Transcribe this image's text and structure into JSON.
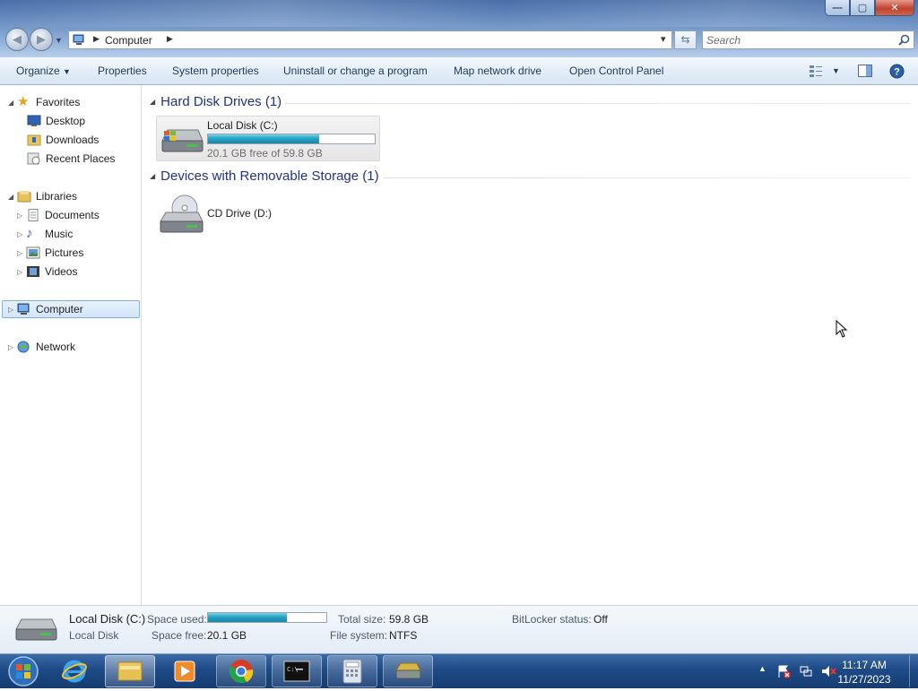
{
  "window": {
    "controls": {
      "minimize": "—",
      "maximize": "▢",
      "close": "✕"
    }
  },
  "nav": {
    "back_icon": "back-arrow-icon",
    "forward_icon": "forward-arrow-icon",
    "breadcrumb": [
      "Computer"
    ],
    "address_dropdown": "▾",
    "refresh_icon": "refresh-icon",
    "search_placeholder": "Search"
  },
  "toolbar": {
    "organize": "Organize",
    "properties": "Properties",
    "system_properties": "System properties",
    "uninstall": "Uninstall or change a program",
    "map_drive": "Map network drive",
    "control_panel": "Open Control Panel"
  },
  "sidebar": {
    "favorites": {
      "label": "Favorites",
      "items": [
        "Desktop",
        "Downloads",
        "Recent Places"
      ]
    },
    "libraries": {
      "label": "Libraries",
      "items": [
        "Documents",
        "Music",
        "Pictures",
        "Videos"
      ]
    },
    "computer": "Computer",
    "network": "Network"
  },
  "groups": {
    "hdd": {
      "title": "Hard Disk Drives (1)"
    },
    "removable": {
      "title": "Devices with Removable Storage (1)"
    }
  },
  "drives": {
    "c": {
      "name": "Local Disk (C:)",
      "free_text": "20.1 GB free of 59.8 GB",
      "used_fraction": 0.664
    },
    "d": {
      "name": "CD Drive (D:)"
    }
  },
  "details": {
    "title": "Local Disk (C:)",
    "subtitle": "Local Disk",
    "space_used_label": "Space used:",
    "space_free_label": "Space free:",
    "space_free": "20.1 GB",
    "total_label": "Total size:",
    "total": "59.8 GB",
    "fs_label": "File system:",
    "fs": "NTFS",
    "bitlocker_label": "BitLocker status:",
    "bitlocker": "Off",
    "used_fraction": 0.664
  },
  "taskbar": {
    "time": "11:17 AM",
    "date": "11/27/2023",
    "apps": [
      "start-orb",
      "internet-explorer",
      "windows-explorer",
      "media-player",
      "chrome",
      "command-prompt",
      "calculator",
      "drive-tool"
    ]
  },
  "colors": {
    "accent": "#1e3287",
    "bar_fill": "#27a2c4",
    "selection": "#d2e5fa"
  }
}
